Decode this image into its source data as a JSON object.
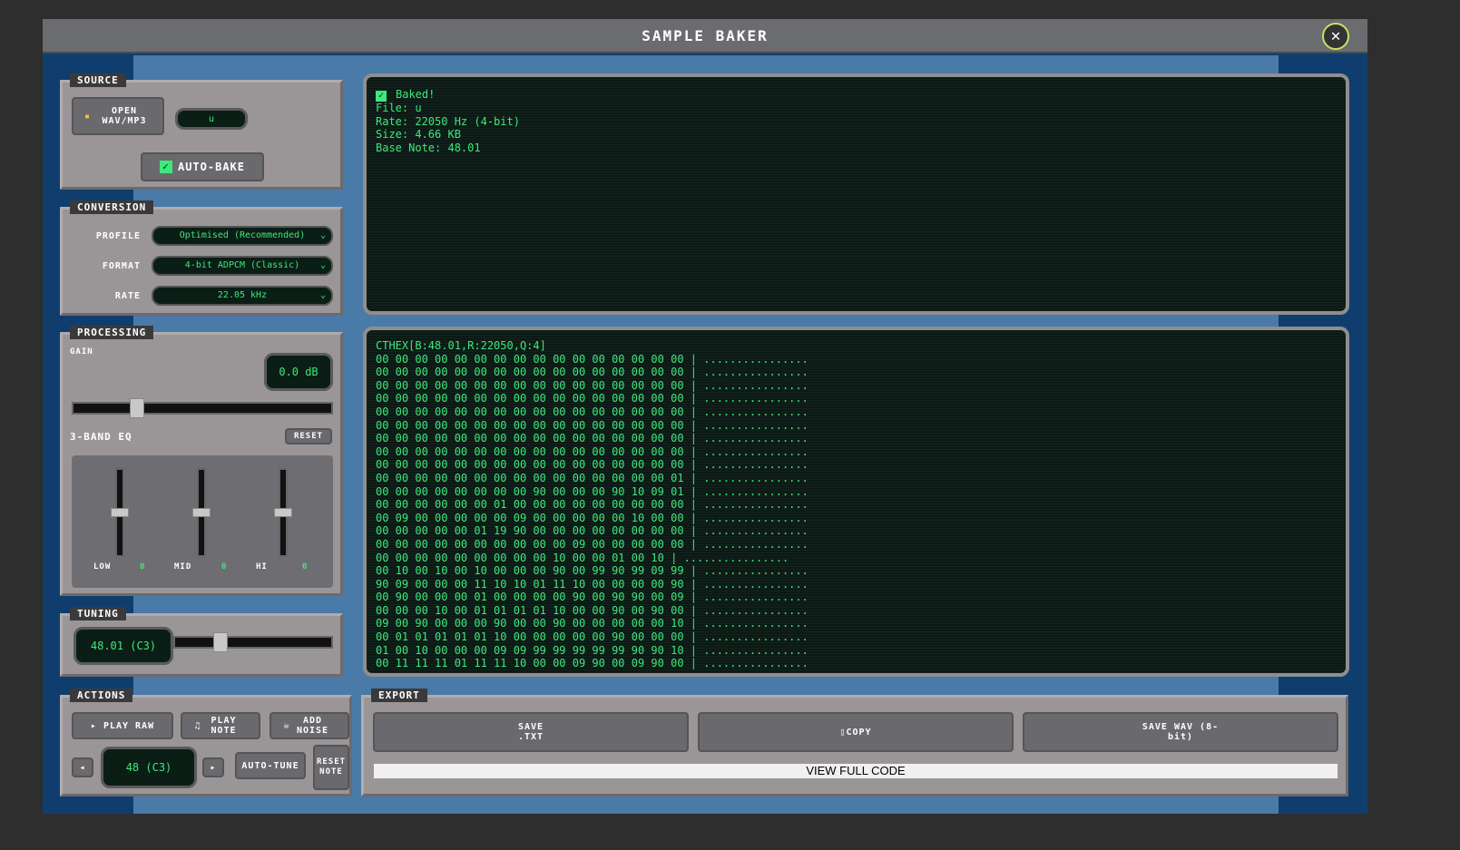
{
  "title": "SAMPLE BAKER",
  "source": {
    "label": "SOURCE",
    "open_button": "OPEN WAV/MP3",
    "file": "u",
    "auto_bake": "AUTO-BAKE",
    "auto_bake_checked": true
  },
  "conversion": {
    "label": "CONVERSION",
    "profile_label": "PROFILE",
    "profile": "Optimised (Recommended)",
    "format_label": "FORMAT",
    "format": "4-bit ADPCM (Classic)",
    "rate_label": "RATE",
    "rate": "22.05 kHz"
  },
  "processing": {
    "label": "PROCESSING",
    "gain_label": "GAIN",
    "gain": "0.0 dB",
    "eq_label": "3-BAND EQ",
    "reset": "RESET",
    "bands": [
      {
        "label": "LOW",
        "value": "0"
      },
      {
        "label": "MID",
        "value": "0"
      },
      {
        "label": "HI",
        "value": "0"
      }
    ]
  },
  "tuning": {
    "label": "TUNING",
    "value": "48.01 (C3)"
  },
  "actions": {
    "label": "ACTIONS",
    "play_raw": "PLAY RAW",
    "play_note": "PLAY NOTE",
    "add_noise": "ADD NOISE",
    "note": "48 (C3)",
    "auto_tune": "AUTO-TUNE",
    "reset_note": "RESET NOTE"
  },
  "status": {
    "baked": "Baked!",
    "file": "File: u",
    "rate": "Rate: 22050 Hz (4-bit)",
    "size": "Size: 4.66 KB",
    "base": "Base Note: 48.01"
  },
  "hex": {
    "header": "CTHEX[B:48.01,R:22050,Q:4]",
    "rows": [
      "00 00 00 00 00 00 00 00 00 00 00 00 00 00 00 00",
      "00 00 00 00 00 00 00 00 00 00 00 00 00 00 00 00",
      "00 00 00 00 00 00 00 00 00 00 00 00 00 00 00 00",
      "00 00 00 00 00 00 00 00 00 00 00 00 00 00 00 00",
      "00 00 00 00 00 00 00 00 00 00 00 00 00 00 00 00",
      "00 00 00 00 00 00 00 00 00 00 00 00 00 00 00 00",
      "00 00 00 00 00 00 00 00 00 00 00 00 00 00 00 00",
      "00 00 00 00 00 00 00 00 00 00 00 00 00 00 00 00",
      "00 00 00 00 00 00 00 00 00 00 00 00 00 00 00 00",
      "00 00 00 00 00 00 00 00 00 00 00 00 00 00 00 01",
      "00 00 00 00 00 00 00 00 90 00 00 00 90 10 09 01",
      "00 00 00 00 00 00 01 00 00 00 00 00 00 00 00 00",
      "00 09 00 00 00 00 00 09 00 00 00 00 00 10 00 00",
      "00 00 00 00 00 01 19 90 00 00 00 00 00 00 00 00",
      "00 00 00 00 00 00 00 00 00 00 09 00 00 00 00 00",
      "00 00 00 00 00 00 00 00 00 10 00 00 01 00 10",
      "00 10 00 10 00 10 00 00 00 90 00 99 90 99 09 99",
      "90 09 00 00 00 11 10 10 01 11 10 00 00 00 00 90",
      "00 90 00 00 00 01 00 00 00 00 90 00 90 90 00 09",
      "00 00 00 10 00 01 01 01 01 10 00 00 90 00 90 00",
      "09 00 90 00 00 00 90 00 00 90 00 00 00 00 00 10",
      "00 01 01 01 01 01 10 00 00 00 00 00 90 00 00 00",
      "01 00 10 00 00 00 09 09 99 99 99 99 99 90 90 10",
      "00 11 11 11 01 11 11 10 00 00 09 90 00 09 90 00"
    ],
    "ascii": "................"
  },
  "export": {
    "label": "EXPORT",
    "save_txt": "SAVE .TXT",
    "copy": "COPY",
    "save_wav": "SAVE WAV (8-bit)",
    "view_full": "VIEW FULL CODE"
  },
  "colors": {
    "accent": "#3ee87a",
    "panel": "#9a9698",
    "frame": "#0f3e6e"
  }
}
